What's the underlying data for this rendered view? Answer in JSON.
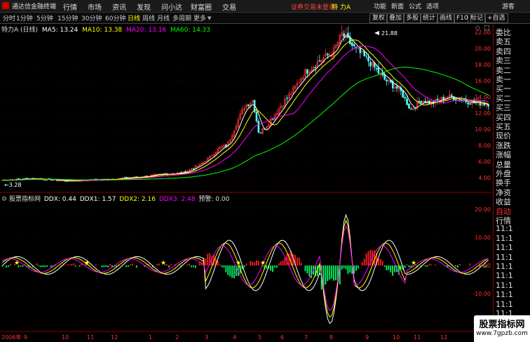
{
  "titlebar": {
    "app_name": "通达信金融终端",
    "menus": [
      "行情",
      "市场",
      "资讯",
      "发现",
      "问小达",
      "财富圈",
      "交易"
    ],
    "warning": "证券交易未登录",
    "stock_name": "特 力A",
    "right_menus": [
      "功能",
      "新面",
      "公式",
      "选项"
    ],
    "user": "游客"
  },
  "toolbar": {
    "periods": [
      "分时",
      "1分钟",
      "5分钟",
      "15分钟",
      "30分钟",
      "60分钟",
      "日线",
      "周线",
      "月线",
      "多周期",
      "更多"
    ],
    "active_period": "日线",
    "buttons": [
      "复权",
      "叠加",
      "多股",
      "统计",
      "画线",
      "F10",
      "标记",
      "+自选"
    ]
  },
  "main_info": {
    "label": "特力A (日线)",
    "ma5": "MA5: 13.24",
    "ma10": "MA10: 13.38",
    "ma20": "MA20: 13.16",
    "ma60": "MA60: 14.33",
    "high_label": "21.88",
    "low_label": "3.28"
  },
  "sub_info": {
    "label": "股票指标网",
    "ddx": "DDX: 0.44",
    "ddx1": "DDX1: 1.57",
    "ddx2": "DDX2: 2.16",
    "ddx3": "DDX3: 2.48",
    "alert": "预警: 0.00"
  },
  "price_axis": [
    "22.00",
    "20.00",
    "18.00",
    "16.00",
    "14.00",
    "12.00",
    "10.00",
    "8.00",
    "6.00",
    "4.00"
  ],
  "ind_axis": [
    "20.00",
    "10.00",
    "0.00",
    "-10.00",
    "-20.00"
  ],
  "date_axis": [
    "2006年",
    "9",
    "10",
    "11",
    "12",
    "1",
    "2",
    "3",
    "4",
    "5",
    "6",
    "7",
    "8",
    "9",
    "10",
    "11",
    "12"
  ],
  "right_panel": [
    "委比",
    "卖五",
    "卖四",
    "卖三",
    "卖二",
    "卖一",
    "买一",
    "买二",
    "买三",
    "买四",
    "买五",
    "现价",
    "涨跌",
    "涨幅",
    "总量",
    "外盘",
    "换手",
    "净资",
    "收益",
    "自动",
    "行情",
    "11:1",
    "11:1",
    "11:1",
    "11:1",
    "11:1",
    "11:1",
    "11:1",
    "11:1",
    "11:1",
    "11:1",
    "11:1"
  ],
  "watermark": "股票指标网",
  "watermark_url": "www.7gpzb.com",
  "colors": {
    "ma5": "#ffffff",
    "ma10": "#ffff00",
    "ma20": "#ff00ff",
    "ma60": "#00ff00",
    "up": "#ff3232",
    "down": "#54ffff",
    "axis": "#8b0000"
  }
}
